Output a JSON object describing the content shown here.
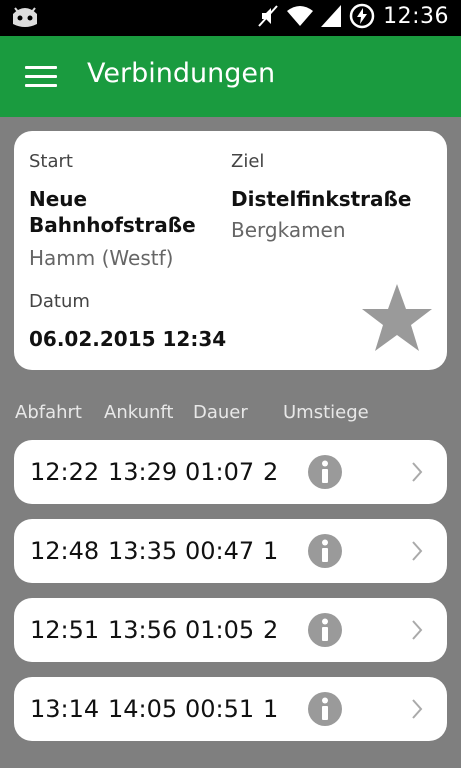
{
  "status_bar": {
    "time": "12:36"
  },
  "app_bar": {
    "title": "Verbindungen"
  },
  "search": {
    "start_label": "Start",
    "start_name": "Neue Bahnhofstraße",
    "start_name_line1": "Neue",
    "start_name_line2": "Bahnhofstraße",
    "start_city": "Hamm (Westf)",
    "ziel_label": "Ziel",
    "ziel_name": "Distelfinkstraße",
    "ziel_city": "Bergkamen",
    "datum_label": "Datum",
    "datum_value": "06.02.2015 12:34"
  },
  "columns": [
    "Abfahrt",
    "Ankunft",
    "Dauer",
    "Umstiege"
  ],
  "connections": [
    {
      "abfahrt": "12:22",
      "ankunft": "13:29",
      "dauer": "01:07",
      "umstiege": "2"
    },
    {
      "abfahrt": "12:48",
      "ankunft": "13:35",
      "dauer": "00:47",
      "umstiege": "1"
    },
    {
      "abfahrt": "12:51",
      "ankunft": "13:56",
      "dauer": "01:05",
      "umstiege": "2"
    },
    {
      "abfahrt": "13:14",
      "ankunft": "14:05",
      "dauer": "00:51",
      "umstiege": "1"
    }
  ],
  "colors": {
    "app_bar": "#1a9b3f",
    "background": "#7f7f7f",
    "info_icon": "#999999",
    "star_icon": "#999999"
  },
  "icons": {
    "menu": "hamburger-menu-icon",
    "favorite": "star-icon",
    "info": "info-icon",
    "row_arrow": "chevron-right-icon"
  }
}
